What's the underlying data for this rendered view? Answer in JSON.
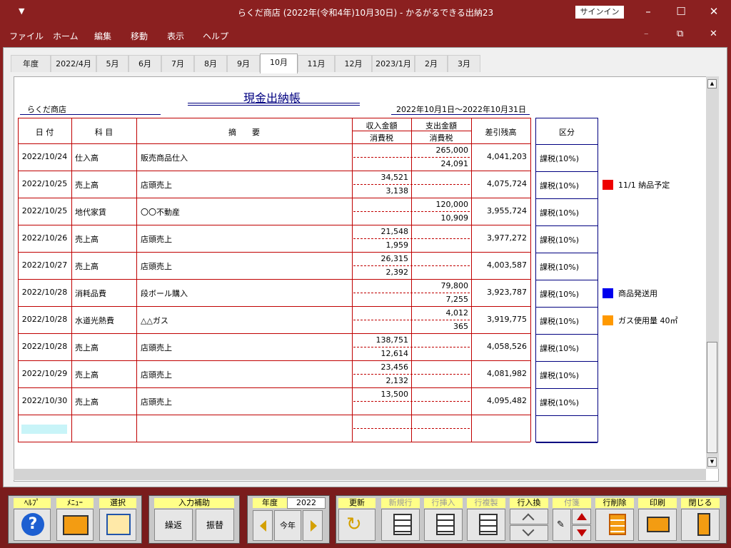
{
  "window": {
    "title": "らくだ商店 (2022年(令和4年)10月30日)  -  かるがるできる出納23",
    "signin": "サインイン"
  },
  "menu": [
    "ファイル",
    "ホーム",
    "編集",
    "移動",
    "表示",
    "ヘルプ"
  ],
  "tabs": [
    "年度",
    "2022/4月",
    "5月",
    "6月",
    "7月",
    "8月",
    "9月",
    "10月",
    "11月",
    "12月",
    "2023/1月",
    "2月",
    "3月"
  ],
  "active_tab": "10月",
  "ledger": {
    "title": "現金出納帳",
    "shop": "らくだ商店",
    "period": "2022年10月1日～2022年10月31日",
    "headers": {
      "date": "日 付",
      "account": "科 目",
      "desc": "摘　　要",
      "income": "収入金額",
      "expense": "支出金額",
      "tax": "消費税",
      "balance": "差引残高",
      "kubun": "区分"
    },
    "rows": [
      {
        "date": "2022/10/24",
        "account": "仕入高",
        "desc": "販売商品仕入",
        "income": "",
        "income_tax": "",
        "expense": "265,000",
        "expense_tax": "24,091",
        "balance": "4,041,203",
        "kubun": "課税(10%)",
        "note": "",
        "note_color": ""
      },
      {
        "date": "2022/10/25",
        "account": "売上高",
        "desc": "店頭売上",
        "income": "34,521",
        "income_tax": "3,138",
        "expense": "",
        "expense_tax": "",
        "balance": "4,075,724",
        "kubun": "課税(10%)",
        "note": "11/1  納品予定",
        "note_color": "#ee0000"
      },
      {
        "date": "2022/10/25",
        "account": "地代家賃",
        "desc": "〇〇不動産",
        "income": "",
        "income_tax": "",
        "expense": "120,000",
        "expense_tax": "10,909",
        "balance": "3,955,724",
        "kubun": "課税(10%)",
        "note": "",
        "note_color": ""
      },
      {
        "date": "2022/10/26",
        "account": "売上高",
        "desc": "店頭売上",
        "income": "21,548",
        "income_tax": "1,959",
        "expense": "",
        "expense_tax": "",
        "balance": "3,977,272",
        "kubun": "課税(10%)",
        "note": "",
        "note_color": ""
      },
      {
        "date": "2022/10/27",
        "account": "売上高",
        "desc": "店頭売上",
        "income": "26,315",
        "income_tax": "2,392",
        "expense": "",
        "expense_tax": "",
        "balance": "4,003,587",
        "kubun": "課税(10%)",
        "note": "",
        "note_color": ""
      },
      {
        "date": "2022/10/28",
        "account": "消耗品費",
        "desc": "段ボール購入",
        "income": "",
        "income_tax": "",
        "expense": "79,800",
        "expense_tax": "7,255",
        "balance": "3,923,787",
        "kubun": "課税(10%)",
        "note": "商品発送用",
        "note_color": "#0000ee"
      },
      {
        "date": "2022/10/28",
        "account": "水道光熱費",
        "desc": "△△ガス",
        "income": "",
        "income_tax": "",
        "expense": "4,012",
        "expense_tax": "365",
        "balance": "3,919,775",
        "kubun": "課税(10%)",
        "note": "ガス使用量  40㎥",
        "note_color": "#ff9900"
      },
      {
        "date": "2022/10/28",
        "account": "売上高",
        "desc": "店頭売上",
        "income": "138,751",
        "income_tax": "12,614",
        "expense": "",
        "expense_tax": "",
        "balance": "4,058,526",
        "kubun": "課税(10%)",
        "note": "",
        "note_color": ""
      },
      {
        "date": "2022/10/29",
        "account": "売上高",
        "desc": "店頭売上",
        "income": "23,456",
        "income_tax": "2,132",
        "expense": "",
        "expense_tax": "",
        "balance": "4,081,982",
        "kubun": "課税(10%)",
        "note": "",
        "note_color": ""
      },
      {
        "date": "2022/10/30",
        "account": "売上高",
        "desc": "店頭売上",
        "income": "13,500",
        "income_tax": "",
        "expense": "",
        "expense_tax": "",
        "balance": "4,095,482",
        "kubun": "課税(10%)",
        "note": "",
        "note_color": ""
      }
    ]
  },
  "toolbar": {
    "help": "ﾍﾙﾌﾟ",
    "menu": "ﾒﾆｭｰ",
    "select": "選択",
    "input_assist": "入力補助",
    "carry": "繰返",
    "transfer": "振替",
    "year_label": "年度",
    "year_value": "2022",
    "this_year": "今年",
    "update": "更新",
    "new_row": "新規行",
    "insert_row": "行挿入",
    "copy_row": "行複製",
    "swap_row": "行入換",
    "sticky": "付箋",
    "delete_row": "行削除",
    "print": "印刷",
    "close": "閉じる"
  }
}
